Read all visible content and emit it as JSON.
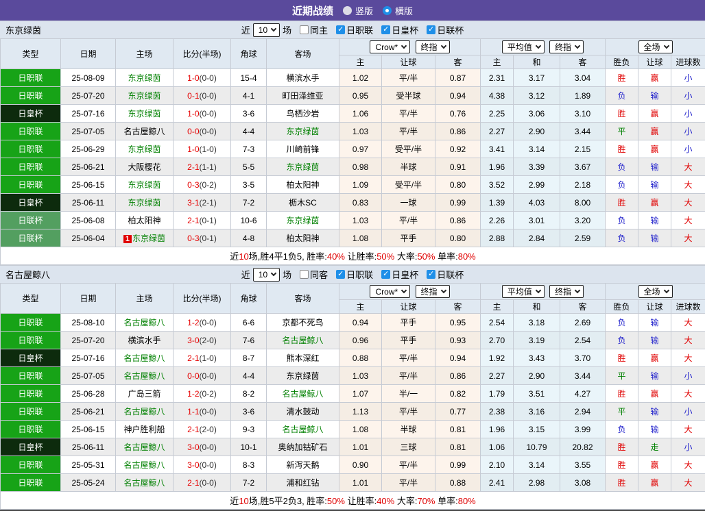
{
  "title_bar": {
    "title": "近期战绩",
    "radio_vertical": "竖版",
    "radio_horizontal": "横版"
  },
  "colors": {
    "accent_purple": "#5a4a9c",
    "league_j1": "#17a317",
    "league_emperor": "#0d2b0d",
    "league_cup": "#539f60",
    "team_green": "#008000",
    "score_red": "#e60000",
    "win_red": "#e00000",
    "loss_blue": "#2323cc",
    "draw_green": "#008000",
    "crow_bg": "#fdf4ec",
    "avg_bg": "#eaf5fa",
    "header_bg": "#e0e9f2",
    "filter_bg": "#dce4ee",
    "checkbox_blue": "#1f8fe8"
  },
  "filter_labels": {
    "near": "近",
    "games": "场"
  },
  "dropdowns": {
    "crow": "Crow*",
    "final1": "终指",
    "average": "平均值",
    "final2": "终指",
    "fullmatch": "全场"
  },
  "columns": {
    "type": "类型",
    "date": "日期",
    "home": "主场",
    "score": "比分(半场)",
    "corner": "角球",
    "away": "客场",
    "crow_home": "主",
    "crow_handicap": "让球",
    "crow_away": "客",
    "avg_home": "主",
    "avg_draw": "和",
    "avg_away": "客",
    "wl": "胜负",
    "handicap": "让球",
    "goals": "进球数"
  },
  "tables": [
    {
      "team": "东京绿茵",
      "filter": {
        "count": "10",
        "same_label": "同主",
        "leagues": [
          "日职联",
          "日皇杯",
          "日联杯"
        ]
      },
      "rows": [
        {
          "league": "日职联",
          "date": "25-08-09",
          "home": "东京绿茵",
          "home_focus": true,
          "badge": "",
          "score": "1-0",
          "half": "(0-0)",
          "corner": "15-4",
          "away": "横滨水手",
          "away_focus": false,
          "crow": [
            "1.02",
            "平/半",
            "0.87"
          ],
          "avg": [
            "2.31",
            "3.17",
            "3.04"
          ],
          "wl": "胜",
          "handicap": "赢",
          "goals": "小"
        },
        {
          "league": "日职联",
          "date": "25-07-20",
          "home": "东京绿茵",
          "home_focus": true,
          "badge": "",
          "score": "0-1",
          "half": "(0-0)",
          "corner": "4-1",
          "away": "町田泽维亚",
          "away_focus": false,
          "crow": [
            "0.95",
            "受半球",
            "0.94"
          ],
          "avg": [
            "4.38",
            "3.12",
            "1.89"
          ],
          "wl": "负",
          "handicap": "输",
          "goals": "小"
        },
        {
          "league": "日皇杯",
          "date": "25-07-16",
          "home": "东京绿茵",
          "home_focus": true,
          "badge": "",
          "score": "1-0",
          "half": "(0-0)",
          "corner": "3-6",
          "away": "鸟栖沙岩",
          "away_focus": false,
          "crow": [
            "1.06",
            "平/半",
            "0.76"
          ],
          "avg": [
            "2.25",
            "3.06",
            "3.10"
          ],
          "wl": "胜",
          "handicap": "赢",
          "goals": "小"
        },
        {
          "league": "日职联",
          "date": "25-07-05",
          "home": "名古屋鲸八",
          "home_focus": false,
          "badge": "",
          "score": "0-0",
          "half": "(0-0)",
          "corner": "4-4",
          "away": "东京绿茵",
          "away_focus": true,
          "crow": [
            "1.03",
            "平/半",
            "0.86"
          ],
          "avg": [
            "2.27",
            "2.90",
            "3.44"
          ],
          "wl": "平",
          "handicap": "赢",
          "goals": "小"
        },
        {
          "league": "日职联",
          "date": "25-06-29",
          "home": "东京绿茵",
          "home_focus": true,
          "badge": "",
          "score": "1-0",
          "half": "(1-0)",
          "corner": "7-3",
          "away": "川崎前锋",
          "away_focus": false,
          "crow": [
            "0.97",
            "受平/半",
            "0.92"
          ],
          "avg": [
            "3.41",
            "3.14",
            "2.15"
          ],
          "wl": "胜",
          "handicap": "赢",
          "goals": "小"
        },
        {
          "league": "日职联",
          "date": "25-06-21",
          "home": "大阪樱花",
          "home_focus": false,
          "badge": "",
          "score": "2-1",
          "half": "(1-1)",
          "corner": "5-5",
          "away": "东京绿茵",
          "away_focus": true,
          "crow": [
            "0.98",
            "半球",
            "0.91"
          ],
          "avg": [
            "1.96",
            "3.39",
            "3.67"
          ],
          "wl": "负",
          "handicap": "输",
          "goals": "大"
        },
        {
          "league": "日职联",
          "date": "25-06-15",
          "home": "东京绿茵",
          "home_focus": true,
          "badge": "",
          "score": "0-3",
          "half": "(0-2)",
          "corner": "3-5",
          "away": "柏太阳神",
          "away_focus": false,
          "crow": [
            "1.09",
            "受平/半",
            "0.80"
          ],
          "avg": [
            "3.52",
            "2.99",
            "2.18"
          ],
          "wl": "负",
          "handicap": "输",
          "goals": "大"
        },
        {
          "league": "日皇杯",
          "date": "25-06-11",
          "home": "东京绿茵",
          "home_focus": true,
          "badge": "",
          "score": "3-1",
          "half": "(2-1)",
          "corner": "7-2",
          "away": "枥木SC",
          "away_focus": false,
          "crow": [
            "0.83",
            "一球",
            "0.99"
          ],
          "avg": [
            "1.39",
            "4.03",
            "8.00"
          ],
          "wl": "胜",
          "handicap": "赢",
          "goals": "大"
        },
        {
          "league": "日联杯",
          "date": "25-06-08",
          "home": "柏太阳神",
          "home_focus": false,
          "badge": "",
          "score": "2-1",
          "half": "(0-1)",
          "corner": "10-6",
          "away": "东京绿茵",
          "away_focus": true,
          "crow": [
            "1.03",
            "平/半",
            "0.86"
          ],
          "avg": [
            "2.26",
            "3.01",
            "3.20"
          ],
          "wl": "负",
          "handicap": "输",
          "goals": "大"
        },
        {
          "league": "日联杯",
          "date": "25-06-04",
          "home": "东京绿茵",
          "home_focus": true,
          "badge": "1",
          "score": "0-3",
          "half": "(0-1)",
          "corner": "4-8",
          "away": "柏太阳神",
          "away_focus": false,
          "crow": [
            "1.08",
            "平手",
            "0.80"
          ],
          "avg": [
            "2.88",
            "2.84",
            "2.59"
          ],
          "wl": "负",
          "handicap": "输",
          "goals": "大"
        }
      ],
      "summary": [
        {
          "text": "近",
          "red": false
        },
        {
          "text": "10",
          "red": true
        },
        {
          "text": "场,胜4平1负5, 胜率:",
          "red": false
        },
        {
          "text": "40%",
          "red": true
        },
        {
          "text": " 让胜率:",
          "red": false
        },
        {
          "text": "50%",
          "red": true
        },
        {
          "text": " 大率:",
          "red": false
        },
        {
          "text": "50%",
          "red": true
        },
        {
          "text": " 单率:",
          "red": false
        },
        {
          "text": "80%",
          "red": true
        }
      ]
    },
    {
      "team": "名古屋鲸八",
      "filter": {
        "count": "10",
        "same_label": "同客",
        "leagues": [
          "日职联",
          "日皇杯",
          "日联杯"
        ]
      },
      "rows": [
        {
          "league": "日职联",
          "date": "25-08-10",
          "home": "名古屋鲸八",
          "home_focus": true,
          "badge": "",
          "score": "1-2",
          "half": "(0-0)",
          "corner": "6-6",
          "away": "京都不死鸟",
          "away_focus": false,
          "crow": [
            "0.94",
            "平手",
            "0.95"
          ],
          "avg": [
            "2.54",
            "3.18",
            "2.69"
          ],
          "wl": "负",
          "handicap": "输",
          "goals": "大"
        },
        {
          "league": "日职联",
          "date": "25-07-20",
          "home": "横滨水手",
          "home_focus": false,
          "badge": "",
          "score": "3-0",
          "half": "(2-0)",
          "corner": "7-6",
          "away": "名古屋鲸八",
          "away_focus": true,
          "crow": [
            "0.96",
            "平手",
            "0.93"
          ],
          "avg": [
            "2.70",
            "3.19",
            "2.54"
          ],
          "wl": "负",
          "handicap": "输",
          "goals": "大"
        },
        {
          "league": "日皇杯",
          "date": "25-07-16",
          "home": "名古屋鲸八",
          "home_focus": true,
          "badge": "",
          "score": "2-1",
          "half": "(1-0)",
          "corner": "8-7",
          "away": "熊本深红",
          "away_focus": false,
          "crow": [
            "0.88",
            "平/半",
            "0.94"
          ],
          "avg": [
            "1.92",
            "3.43",
            "3.70"
          ],
          "wl": "胜",
          "handicap": "赢",
          "goals": "大"
        },
        {
          "league": "日职联",
          "date": "25-07-05",
          "home": "名古屋鲸八",
          "home_focus": true,
          "badge": "",
          "score": "0-0",
          "half": "(0-0)",
          "corner": "4-4",
          "away": "东京绿茵",
          "away_focus": false,
          "crow": [
            "1.03",
            "平/半",
            "0.86"
          ],
          "avg": [
            "2.27",
            "2.90",
            "3.44"
          ],
          "wl": "平",
          "handicap": "输",
          "goals": "小"
        },
        {
          "league": "日职联",
          "date": "25-06-28",
          "home": "广岛三箭",
          "home_focus": false,
          "badge": "",
          "score": "1-2",
          "half": "(0-2)",
          "corner": "8-2",
          "away": "名古屋鲸八",
          "away_focus": true,
          "crow": [
            "1.07",
            "半/一",
            "0.82"
          ],
          "avg": [
            "1.79",
            "3.51",
            "4.27"
          ],
          "wl": "胜",
          "handicap": "赢",
          "goals": "大"
        },
        {
          "league": "日职联",
          "date": "25-06-21",
          "home": "名古屋鲸八",
          "home_focus": true,
          "badge": "",
          "score": "1-1",
          "half": "(0-0)",
          "corner": "3-6",
          "away": "清水鼓动",
          "away_focus": false,
          "crow": [
            "1.13",
            "平/半",
            "0.77"
          ],
          "avg": [
            "2.38",
            "3.16",
            "2.94"
          ],
          "wl": "平",
          "handicap": "输",
          "goals": "小"
        },
        {
          "league": "日职联",
          "date": "25-06-15",
          "home": "神户胜利船",
          "home_focus": false,
          "badge": "",
          "score": "2-1",
          "half": "(2-0)",
          "corner": "9-3",
          "away": "名古屋鲸八",
          "away_focus": true,
          "crow": [
            "1.08",
            "半球",
            "0.81"
          ],
          "avg": [
            "1.96",
            "3.15",
            "3.99"
          ],
          "wl": "负",
          "handicap": "输",
          "goals": "大"
        },
        {
          "league": "日皇杯",
          "date": "25-06-11",
          "home": "名古屋鲸八",
          "home_focus": true,
          "badge": "",
          "score": "3-0",
          "half": "(0-0)",
          "corner": "10-1",
          "away": "奥纳加钴矿石",
          "away_focus": false,
          "crow": [
            "1.01",
            "三球",
            "0.81"
          ],
          "avg": [
            "1.06",
            "10.79",
            "20.82"
          ],
          "wl": "胜",
          "handicap": "走",
          "goals": "小"
        },
        {
          "league": "日职联",
          "date": "25-05-31",
          "home": "名古屋鲸八",
          "home_focus": true,
          "badge": "",
          "score": "3-0",
          "half": "(0-0)",
          "corner": "8-3",
          "away": "新泻天鹅",
          "away_focus": false,
          "crow": [
            "0.90",
            "平/半",
            "0.99"
          ],
          "avg": [
            "2.10",
            "3.14",
            "3.55"
          ],
          "wl": "胜",
          "handicap": "赢",
          "goals": "大"
        },
        {
          "league": "日职联",
          "date": "25-05-24",
          "home": "名古屋鲸八",
          "home_focus": true,
          "badge": "",
          "score": "2-1",
          "half": "(0-0)",
          "corner": "7-2",
          "away": "浦和红钻",
          "away_focus": false,
          "crow": [
            "1.01",
            "平/半",
            "0.88"
          ],
          "avg": [
            "2.41",
            "2.98",
            "3.08"
          ],
          "wl": "胜",
          "handicap": "赢",
          "goals": "大"
        }
      ],
      "summary": [
        {
          "text": "近",
          "red": false
        },
        {
          "text": "10",
          "red": true
        },
        {
          "text": "场,胜5平2负3, 胜率:",
          "red": false
        },
        {
          "text": "50%",
          "red": true
        },
        {
          "text": " 让胜率:",
          "red": false
        },
        {
          "text": "40%",
          "red": true
        },
        {
          "text": " 大率:",
          "red": false
        },
        {
          "text": "70%",
          "red": true
        },
        {
          "text": " 单率:",
          "red": false
        },
        {
          "text": "80%",
          "red": true
        }
      ]
    }
  ]
}
